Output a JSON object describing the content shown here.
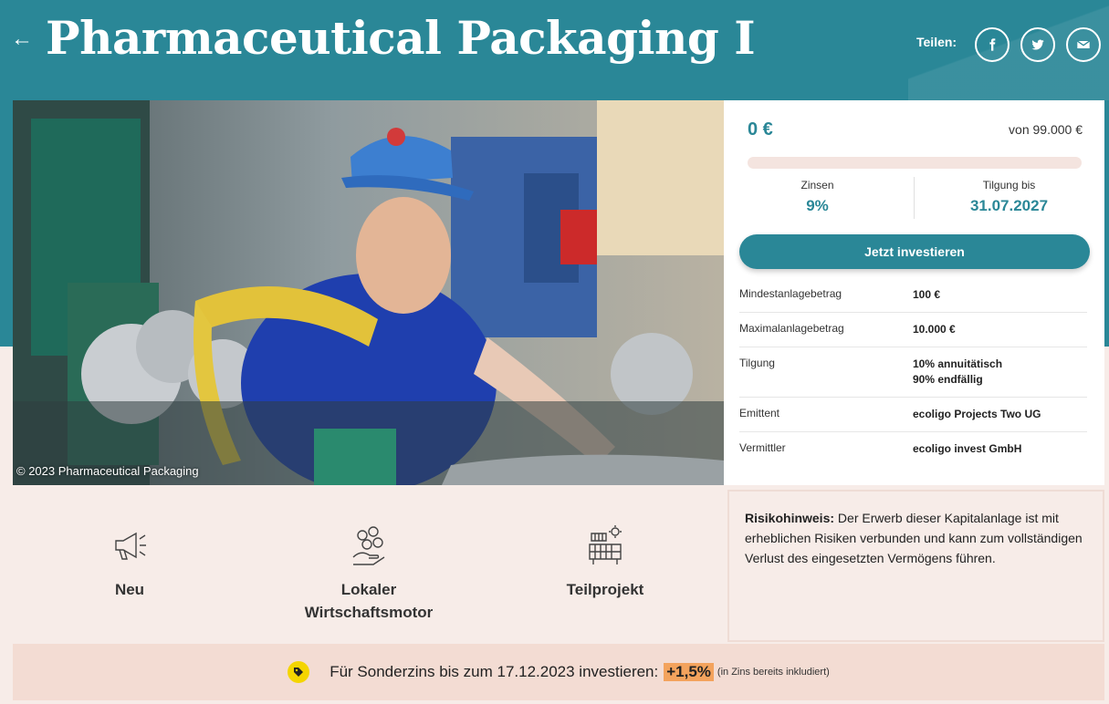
{
  "header": {
    "back_icon": "arrow-left-icon",
    "title": "Pharmaceutical Packaging I",
    "share_label": "Teilen:",
    "share_icons": [
      "facebook-icon",
      "twitter-icon",
      "email-icon"
    ]
  },
  "hero": {
    "photo_credit": "© 2023 Pharmaceutical Packaging"
  },
  "investment": {
    "amount_raised": "0 €",
    "target": "von 99.000 €",
    "progress_fraction": 0,
    "interest_label": "Zinsen",
    "interest_value": "9%",
    "repayment_label": "Tilgung bis",
    "repayment_value": "31.07.2027",
    "cta_label": "Jetzt investieren",
    "details": [
      {
        "label": "Mindestanlagebetrag",
        "value": [
          "100 €"
        ]
      },
      {
        "label": "Maximalanlagebetrag",
        "value": [
          "10.000 €"
        ]
      },
      {
        "label": "Tilgung",
        "value": [
          "10% annuitätisch",
          "90% endfällig"
        ]
      },
      {
        "label": "Emittent",
        "value": [
          "ecoligo Projects Two UG"
        ]
      },
      {
        "label": "Vermittler",
        "value": [
          "ecoligo invest GmbH"
        ]
      }
    ]
  },
  "features": [
    {
      "icon": "megaphone-icon",
      "label": "Neu"
    },
    {
      "icon": "hand-coins-icon",
      "label": "Lokaler Wirtschaftsmotor"
    },
    {
      "icon": "solar-panel-icon",
      "label": "Teilprojekt"
    }
  ],
  "risk": {
    "label": "Risikohinweis:",
    "text": " Der Erwerb dieser Kapitalanlage ist mit erheblichen Risiken verbunden und kann zum vollständigen Verlust des eingesetzten Vermögens führen."
  },
  "bonus": {
    "icon": "tag-icon",
    "text": "Für Sonderzins bis zum 17.12.2023 investieren:",
    "rate": "+1,5%",
    "note": "(in Zins bereits inkludiert)"
  },
  "colors": {
    "primary": "#2a8797",
    "background_light": "#f7ece8",
    "bonus_bar": "#f3dcd3",
    "highlight": "#f3a35d",
    "tag_yellow": "#f4d500"
  }
}
